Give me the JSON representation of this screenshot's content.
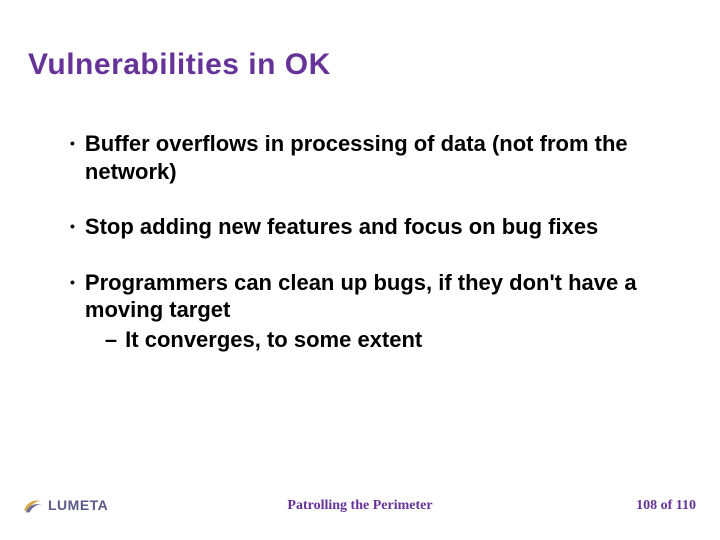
{
  "title": "Vulnerabilities in OK",
  "bullets": [
    {
      "text": "Buffer overflows in processing of data (not from the network)"
    },
    {
      "text": "Stop adding new features and focus on bug fixes"
    },
    {
      "text": "Programmers can clean up bugs, if they don't have a moving target",
      "sub": "It converges, to some extent"
    }
  ],
  "logo_text": "LUMETA",
  "footer_center": "Patrolling the Perimeter",
  "page_current": "108",
  "page_sep": " of  ",
  "page_total": "110"
}
